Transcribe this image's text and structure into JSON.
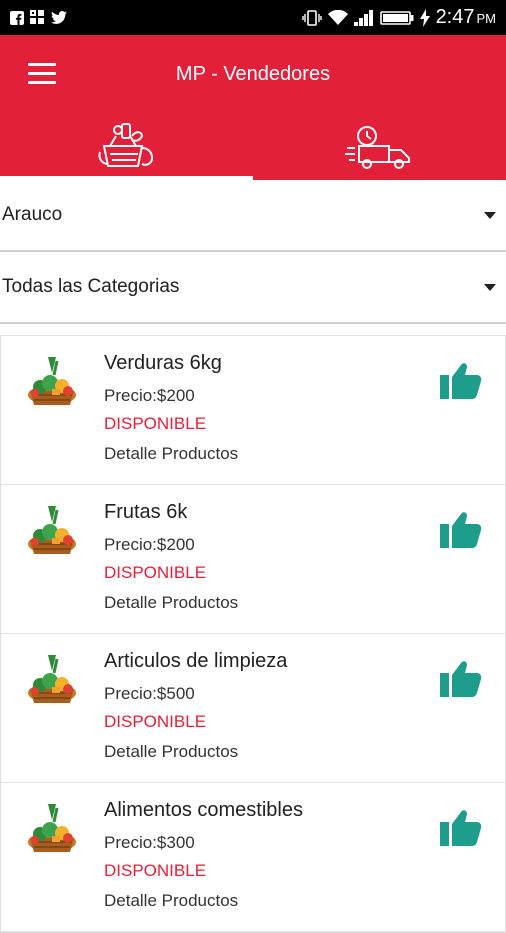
{
  "status_bar": {
    "time": "2:47",
    "ampm": "PM",
    "left_icons": [
      "facebook-icon",
      "gallery-icon",
      "twitter-icon"
    ],
    "right_icons": [
      "vibrate-icon",
      "wifi-icon",
      "signal-icon",
      "battery-icon",
      "charging-icon"
    ]
  },
  "app_bar": {
    "title": "MP - Vendedores",
    "menu_icon": "hamburger-menu-icon"
  },
  "tabs": [
    {
      "icon": "groceries-basket-icon",
      "active": true
    },
    {
      "icon": "delivery-truck-icon",
      "active": false
    }
  ],
  "filters": {
    "location": "Arauco",
    "category": "Todas las Categorias"
  },
  "products": [
    {
      "name": "Verduras 6kg",
      "price": "Precio:$200",
      "status": "DISPONIBLE",
      "detail": "Detalle Productos"
    },
    {
      "name": "Frutas 6k",
      "price": "Precio:$200",
      "status": "DISPONIBLE",
      "detail": "Detalle Productos"
    },
    {
      "name": "Articulos de limpieza",
      "price": "Precio:$500",
      "status": "DISPONIBLE",
      "detail": "Detalle Productos"
    },
    {
      "name": "Alimentos comestibles",
      "price": "Precio:$300",
      "status": "DISPONIBLE",
      "detail": "Detalle Productos"
    }
  ],
  "colors": {
    "primary": "#e3203a",
    "like": "#1e9c8c",
    "status": "#e3203a"
  }
}
